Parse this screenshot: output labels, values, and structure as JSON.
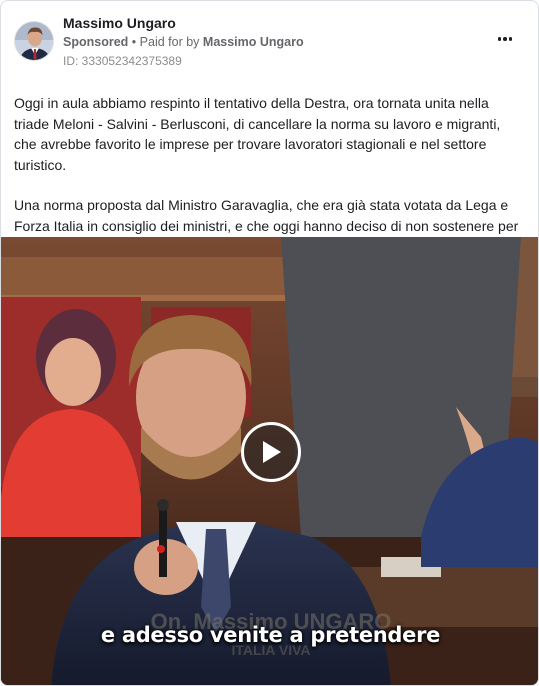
{
  "post": {
    "author_name": "Massimo Ungaro",
    "sponsored_label": "Sponsored",
    "paid_for_prefix": "Paid for by",
    "paid_for_name": "Massimo Ungaro",
    "separator": "•",
    "ad_id": "ID: 333052342375389",
    "more_icon": "more-horizontal-icon",
    "paragraphs": [
      "Oggi in aula abbiamo respinto il tentativo della Destra, ora tornata unita nella triade Meloni - Salvini - Berlusconi, di cancellare la norma su lavoro e migranti, che avrebbe favorito le imprese per trovare lavoratori stagionali e nel settore turistico.",
      "Una norma proposta dal Ministro Garavaglia, che era già stata votata da Lega e Forza Italia in consiglio dei ministri, e che oggi hanno deciso di non sostenere per mero calcolo elettorale. Hanno dimostrato così di fregarsene delle imprese italia…"
    ]
  },
  "video": {
    "caption": "e adesso venite a pretendere",
    "play_icon": "play-icon",
    "lower_third_name": "On. Massimo UNGARO",
    "lower_third_party": "ITALIA VIVA"
  }
}
